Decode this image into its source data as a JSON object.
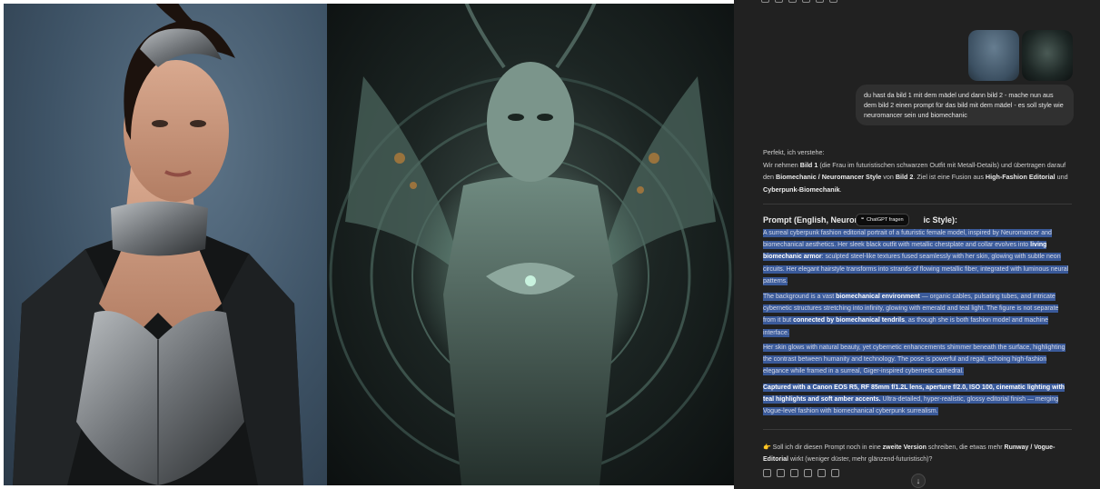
{
  "chat": {
    "user_message": "du hast da bild 1 mit dem mädel und dann bild 2 - mache nun aus dem bild 2 einen prompt für das bild mit dem mädel - es soll style wie neuromancer sein und biomechanic",
    "intro": {
      "line1": "Perfekt, ich verstehe:",
      "p2a": "Wir nehmen ",
      "p2b": "Bild 1",
      "p2c": " (die Frau im futuristischen schwarzen Outfit mit Metall-Details) und übertragen darauf den ",
      "p2d": "Biomechanic / Neuromancer Style",
      "p2e": " von ",
      "p2f": "Bild 2",
      "p2g": ". Ziel ist eine Fusion aus ",
      "p2h": "High-Fashion Editorial",
      "p2i": " und ",
      "p2j": "Cyberpunk-Biomechanik",
      "p2k": "."
    },
    "prompt_title_a": "Prompt (English, Neurom",
    "prompt_title_b": "ic Style):",
    "ask_chip": "ChatGPT fragen",
    "p1a": "A surreal cyberpunk fashion editorial portrait of a futuristic female model, inspired by Neuromancer and biomechanical aesthetics. Her sleek black outfit with metallic chestplate and collar evolves into ",
    "p1b": "living biomechanic armor",
    "p1c": ": sculpted steel-like textures fused seamlessly with her skin, glowing with subtle neon circuits. Her elegant hairstyle transforms into strands of flowing metallic fiber, integrated with luminous neural patterns.",
    "p2a": "The background is a vast ",
    "p2b": "biomechanical environment",
    "p2c": " — organic cables, pulsating tubes, and intricate cybernetic structures stretching into infinity, glowing with emerald and teal light. The figure is not separate from it but ",
    "p2d": "connected by biomechanical tendrils",
    "p2e": ", as though she is both fashion model and machine interface.",
    "p3": "Her skin glows with natural beauty, yet cybernetic enhancements shimmer beneath the surface, highlighting the contrast between humanity and technology. The pose is powerful and regal, echoing high-fashion elegance while framed in a surreal, Giger-inspired cybernetic cathedral.",
    "p4a": "Captured with a Canon EOS R5, RF 85mm f/1.2L lens, aperture f/2.0, ISO 100, cinematic lighting with teal highlights and soft amber accents.",
    "p4b": " Ultra-detailed, hyper-realistic, glossy editorial finish — merging Vogue-level fashion with biomechanical cyberpunk surrealism.",
    "q_a": "👉 Soll ich dir diesen Prompt noch in eine ",
    "q_b": "zweite Version",
    "q_c": " schreiben, die etwas mehr ",
    "q_d": "Runway / Vogue-Editorial",
    "q_e": " wirkt (weniger düster, mehr glänzend-futuristisch)?",
    "scroll_glyph": "↓"
  },
  "icons": [
    "copy-icon",
    "thumbs-up-icon",
    "thumbs-down-icon",
    "speaker-icon",
    "share-icon",
    "regenerate-icon"
  ],
  "colors": {
    "chat_bg": "#212121",
    "bubble_bg": "#303030",
    "selection": "#3a5a9a"
  }
}
